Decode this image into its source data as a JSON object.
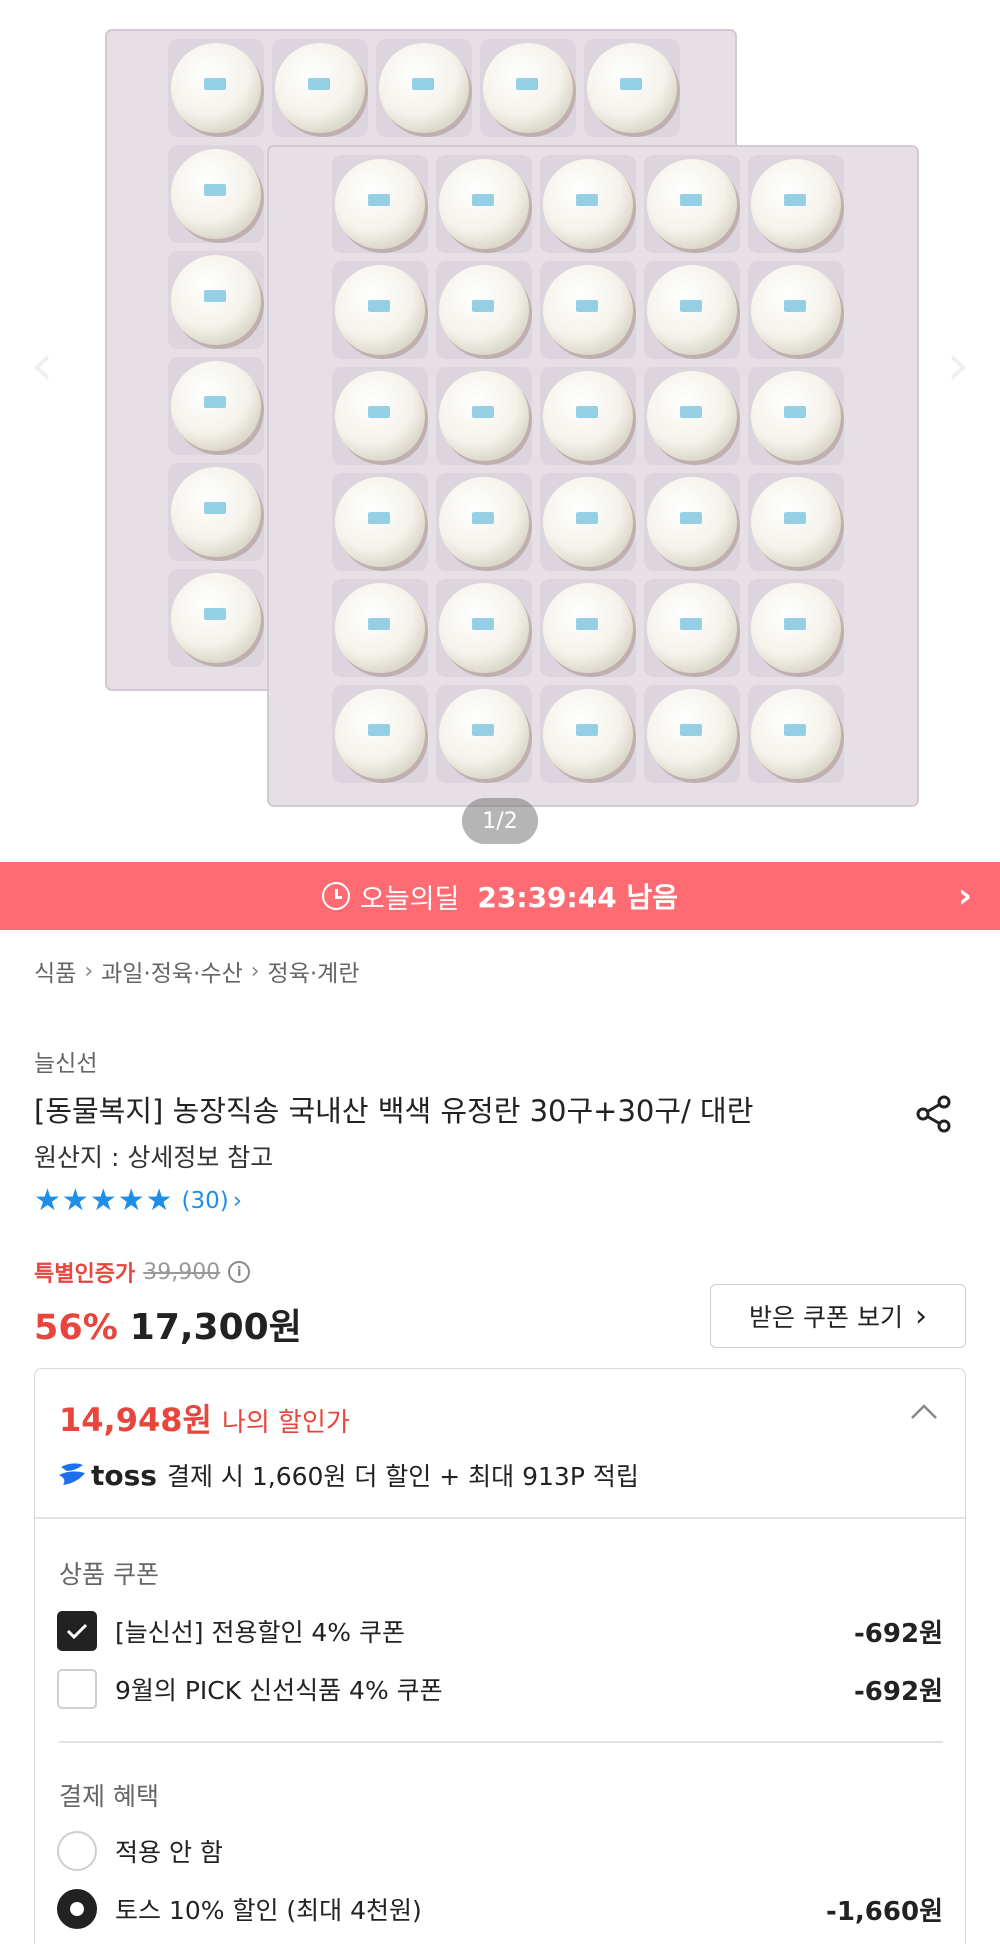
{
  "gallery": {
    "page_indicator": "1/2"
  },
  "deal": {
    "label": "오늘의딜",
    "time_remaining": "23:39:44 남음"
  },
  "breadcrumb": [
    "식품",
    "과일·정육·수산",
    "정육·계란"
  ],
  "product": {
    "brand": "늘신선",
    "title": "[동물복지] 농장직송 국내산 백색 유정란 30구+30구/  대란",
    "origin": "원산지 : 상세정보 참고",
    "rating_stars": 5,
    "review_count": "(30)"
  },
  "price": {
    "special_label": "특별인증가",
    "original_price": "39,900",
    "discount_rate": "56%",
    "sale_price": "17,300원",
    "coupon_button": "받은 쿠폰 보기"
  },
  "discount_box": {
    "my_price": "14,948원",
    "my_price_label": "나의 할인가",
    "toss_brand": "toss",
    "toss_text": "결제 시 1,660원 더 할인 + 최대 913P 적립",
    "product_coupon_title": "상품 쿠폰",
    "coupons": [
      {
        "label": "[늘신선] 전용할인 4% 쿠폰",
        "amount": "-692원",
        "checked": true
      },
      {
        "label": "9월의 PICK 신선식품 4% 쿠폰",
        "amount": "-692원",
        "checked": false
      }
    ],
    "payment_benefit_title": "결제 혜택",
    "payment_options": [
      {
        "label": "적용 안 함",
        "amount": "",
        "selected": false
      },
      {
        "label": "토스 10% 할인 (최대 4천원)",
        "amount": "-1,660원",
        "selected": true
      }
    ]
  },
  "colors": {
    "deal_bar": "#ff6b72",
    "discount_red": "#e8453c",
    "rating_blue": "#1e8fe8",
    "toss_blue": "#1e6ff0"
  },
  "icons": {
    "clock": "clock-icon",
    "chevron": "chevron-right-icon",
    "share": "share-icon",
    "star": "star-icon",
    "info": "info-icon",
    "collapse": "chevron-up-icon",
    "check": "check-icon"
  }
}
